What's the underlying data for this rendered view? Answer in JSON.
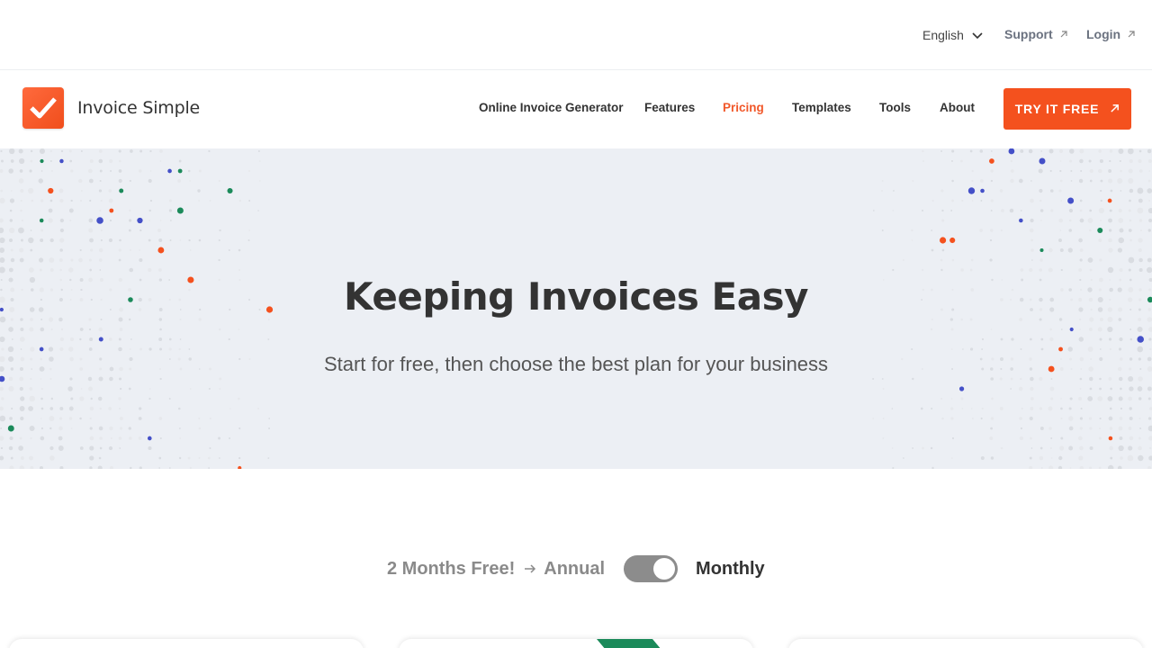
{
  "topbar": {
    "language": "English",
    "support": "Support",
    "login": "Login"
  },
  "nav": {
    "brand": "Invoice Simple",
    "links": [
      {
        "label": "Online Invoice Generator",
        "active": false
      },
      {
        "label": "Features",
        "active": false
      },
      {
        "label": "Pricing",
        "active": true
      },
      {
        "label": "Templates",
        "active": false
      },
      {
        "label": "Tools",
        "active": false
      },
      {
        "label": "About",
        "active": false
      }
    ],
    "cta": "TRY IT FREE"
  },
  "hero": {
    "title": "Keeping Invoices Easy",
    "subtitle": "Start for free, then choose the best plan for your business"
  },
  "billing": {
    "promo": "2 Months Free!",
    "annual": "Annual",
    "monthly": "Monthly",
    "selected": "Monthly"
  },
  "colors": {
    "brand_orange": "#f4511e",
    "accent_green": "#1b8a5a",
    "accent_blue": "#4450c8",
    "hero_bg": "#eceff4",
    "toggle_bg": "#8c8c8c"
  },
  "icons": {
    "language_chevron": "chevron-down-icon",
    "support_external": "external-link-icon",
    "login_external": "external-link-icon",
    "cta_arrow": "arrow-up-right-icon",
    "logo": "checkmark-logo-icon",
    "promo_arrow": "arrow-right-icon"
  }
}
